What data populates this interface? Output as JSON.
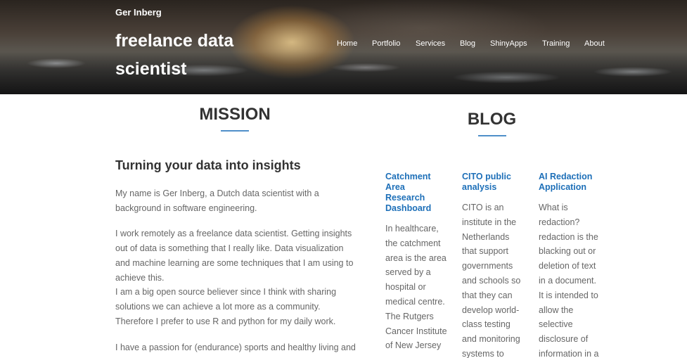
{
  "header": {
    "site_name": "Ger Inberg",
    "tagline": "freelance data scientist",
    "nav": [
      "Home",
      "Portfolio",
      "Services",
      "Blog",
      "ShinyApps",
      "Training",
      "About"
    ]
  },
  "mission": {
    "title": "MISSION",
    "subtitle": "Turning your data into insights",
    "p1": "My name is Ger Inberg, a Dutch data scientist with a background in software engineering.",
    "p2a": "I work remotely as a freelance data scientist. Getting insights out of data is something that I really like. Data visualization and machine learning are some techniques that I am using to achieve this.",
    "p2b": "I am a big open source believer since I think with sharing solutions we can achieve a lot more as a community. Therefore I prefer to use R and python for my daily work.",
    "p3": "I have a passion for (endurance) sports and healthy living and"
  },
  "blog": {
    "title": "BLOG",
    "posts": [
      {
        "title": "Catchment Area Research Dashboard",
        "excerpt": "In healthcare, the catchment area is the area served by a hospital or medical centre. The Rutgers Cancer Institute of New Jersey"
      },
      {
        "title": "CITO public analysis",
        "excerpt": "CITO is an institute in the Netherlands that support governments and schools so that they can develop world-class testing and monitoring systems to"
      },
      {
        "title": "AI Redaction Application",
        "excerpt": "What is redaction? redaction is the blacking out or deletion of text in a document. It is intended to allow the selective disclosure of information in a"
      }
    ]
  },
  "colors": {
    "accent": "#4f8fc9",
    "link": "#1d6fb8",
    "heading": "#333333",
    "body_text": "#666666"
  }
}
